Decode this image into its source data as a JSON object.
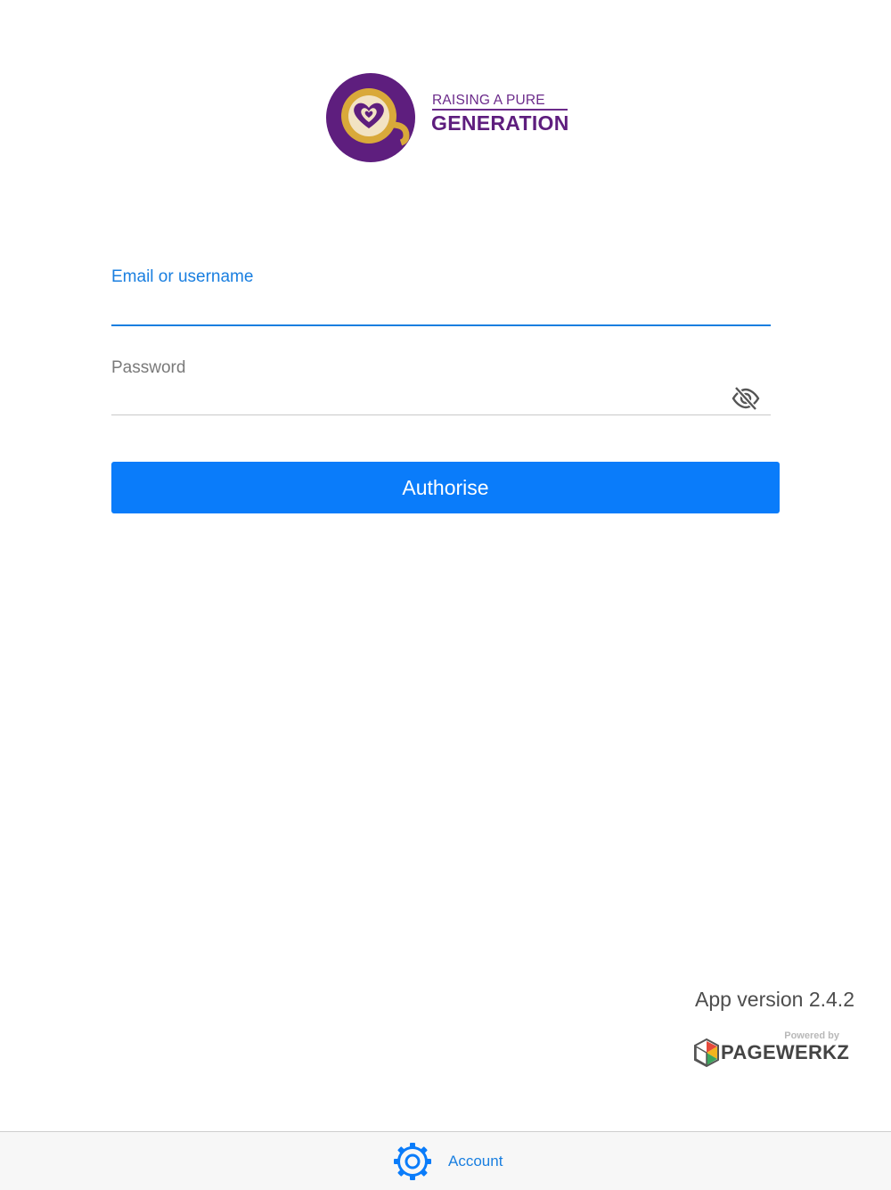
{
  "brand": {
    "logo_top": "RAISING A PURE",
    "logo_main": "GENERATION",
    "icon": "coffee-cup-heart-logo",
    "colors": {
      "purple": "#5e1e7e",
      "gold": "#d9a93a"
    }
  },
  "login": {
    "email_label": "Email or username",
    "email_value": "",
    "password_label": "Password",
    "password_value": "",
    "password_toggle_icon": "eye-slash-icon",
    "authorise_label": "Authorise"
  },
  "footer": {
    "app_version": "App version 2.4.2",
    "powered_by": "Powered by",
    "provider": "PAGEWERKZ"
  },
  "tab_bar": {
    "account_label": "Account",
    "account_icon": "gear-icon"
  },
  "colors": {
    "accent": "#0a7cfa",
    "link": "#1a7fe0",
    "background": "#ffffff",
    "tab_bar": "#f7f7f7"
  }
}
